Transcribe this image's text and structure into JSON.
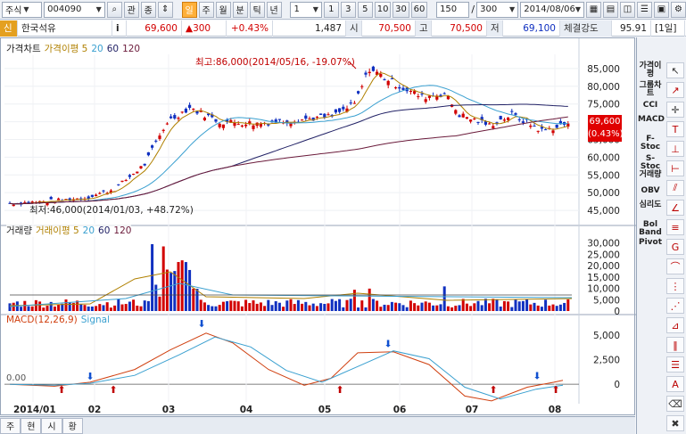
{
  "toolbar": {
    "market": "주식",
    "code": "004090",
    "search_btn": "⌕",
    "buttons": [
      "관",
      "종"
    ],
    "periods": [
      "일",
      "주",
      "월",
      "분",
      "틱",
      "년"
    ],
    "minute_select": "1",
    "minute_options": [
      "1",
      "3",
      "5",
      "10",
      "30",
      "60"
    ],
    "count_value": "150",
    "count_sep": "/",
    "count_total": "300",
    "date": "2014/08/06"
  },
  "info": {
    "status": "신",
    "name": "한국석유",
    "i_label": "i",
    "price": "69,600",
    "change": "▲300",
    "rate": "+0.43%",
    "volume": "1,487",
    "open_label": "시",
    "open": "70,500",
    "high_label": "고",
    "high": "70,500",
    "low_label": "저",
    "low": "69,100",
    "strength_label": "체결강도",
    "strength": "95.91",
    "period_label": "[1일]"
  },
  "price_panel": {
    "legend": [
      "가격차트",
      "가격이평 5",
      "20",
      "60",
      "120"
    ],
    "high_note": "최고:86,000(2014/05/16, -19.07%)",
    "low_note": "최저:46,000(2014/01/03, +48.72%)",
    "price_ticks": [
      "85,000",
      "80,000",
      "75,000",
      "70,000",
      "65,000",
      "60,000",
      "55,000",
      "50,000",
      "45,000"
    ],
    "badge_price": "69,600",
    "badge_rate": "(0.43%)"
  },
  "volume_panel": {
    "legend": [
      "거래량",
      "거래이평 5",
      "20",
      "60",
      "120"
    ],
    "ticks": [
      "30,000",
      "25,000",
      "20,000",
      "15,000",
      "10,000",
      "5,000",
      "0"
    ]
  },
  "macd_panel": {
    "legend": [
      "MACD(12,26,9)",
      "Signal"
    ],
    "ticks": [
      "5,000",
      "2,500",
      "0"
    ],
    "zero_label": "0.00"
  },
  "x_axis": [
    "2014/01",
    "02",
    "03",
    "04",
    "05",
    "06",
    "07",
    "08"
  ],
  "right_tools": [
    "가격이평",
    "그룹차트",
    "CCI",
    "MACD",
    "F-Stoc",
    "S-Stoc",
    "거래량",
    "OBV",
    "심리도",
    "Bol Band",
    "Pivot"
  ],
  "bottom_tabs": [
    "주",
    "현",
    "시",
    "황"
  ],
  "colors": {
    "up": "#d20000",
    "down": "#1030c0",
    "ma5": "#b08000",
    "ma20": "#3aa0d0",
    "ma60": "#222266",
    "ma120": "#6a1a3a"
  }
}
